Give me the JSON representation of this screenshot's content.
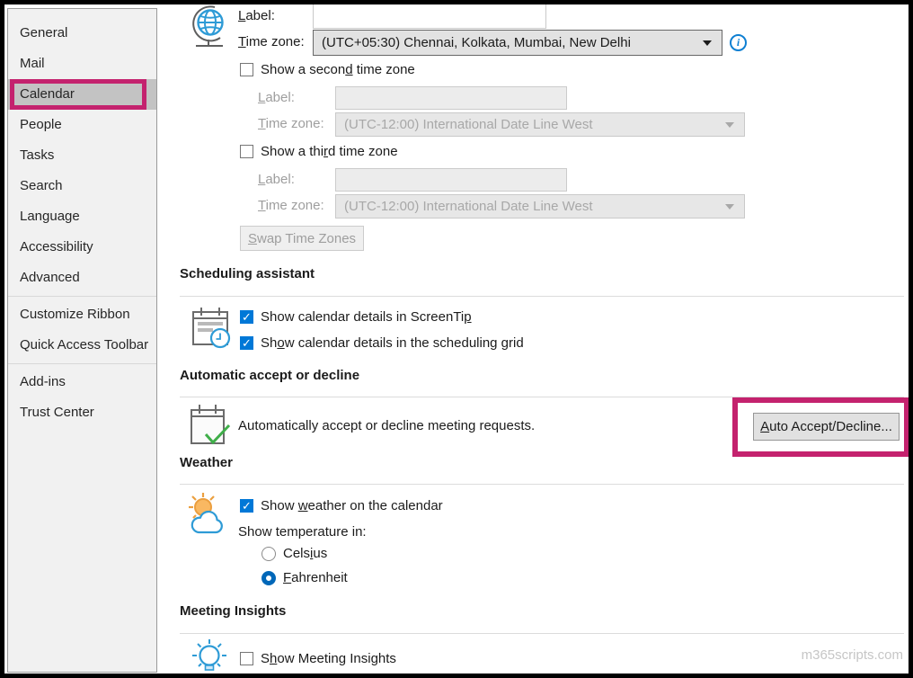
{
  "colors": {
    "annotation_highlight": "#c4226e",
    "checkbox_blue": "#0078d7",
    "radio_blue": "#0067b8",
    "selected_item_bg": "#c3c3c3",
    "icon_blue": "#2e9bd6",
    "check_green": "#3fae49",
    "sun_orange": "#eb9f3f"
  },
  "sidebar": {
    "items": [
      {
        "label": "General",
        "selected": false
      },
      {
        "label": "Mail",
        "selected": false
      },
      {
        "label": "Calendar",
        "selected": true
      },
      {
        "label": "People",
        "selected": false
      },
      {
        "label": "Tasks",
        "selected": false
      },
      {
        "label": "Search",
        "selected": false
      },
      {
        "label": "Language",
        "selected": false
      },
      {
        "label": "Accessibility",
        "selected": false
      },
      {
        "label": "Advanced",
        "selected": false
      },
      {
        "label": "Customize Ribbon",
        "selected": false
      },
      {
        "label": "Quick Access Toolbar",
        "selected": false
      },
      {
        "label": "Add-ins",
        "selected": false
      },
      {
        "label": "Trust Center",
        "selected": false
      }
    ]
  },
  "timezones": {
    "primary": {
      "label": {
        "pre": "",
        "key": "L",
        "post": "abel:"
      },
      "value": "",
      "tz_label": {
        "pre": "",
        "key": "T",
        "post": "ime zone:"
      },
      "tz_value": "(UTC+05:30) Chennai, Kolkata, Mumbai, New Delhi"
    },
    "second": {
      "toggle": {
        "pre": "Show a secon",
        "key": "d",
        "post": " time zone"
      },
      "checked": false,
      "label": {
        "pre": "",
        "key": "L",
        "post": "abel:"
      },
      "value": "",
      "tz_label": {
        "pre": "",
        "key": "T",
        "post": "ime zone:"
      },
      "tz_value": "(UTC-12:00) International Date Line West"
    },
    "third": {
      "toggle": {
        "pre": "Show a thi",
        "key": "r",
        "post": "d time zone"
      },
      "checked": false,
      "label": {
        "pre": "",
        "key": "L",
        "post": "abel:"
      },
      "value": "",
      "tz_label": {
        "pre": "",
        "key": "T",
        "post": "ime zone:"
      },
      "tz_value": "(UTC-12:00) International Date Line West"
    },
    "swap_button": {
      "pre": "",
      "key": "S",
      "post": "wap Time Zones"
    }
  },
  "scheduling": {
    "title": "Scheduling assistant",
    "screentip": {
      "pre": "Show calendar details in ScreenTi",
      "key": "p",
      "post": "",
      "checked": true
    },
    "grid": {
      "pre": "Sh",
      "key": "o",
      "post": "w calendar details in the scheduling grid",
      "checked": true
    }
  },
  "auto_accept": {
    "title": "Automatic accept or decline",
    "description": "Automatically accept or decline meeting requests.",
    "button": {
      "pre": "",
      "key": "A",
      "post": "uto Accept/Decline..."
    }
  },
  "weather": {
    "title": "Weather",
    "show_weather": {
      "pre": "Show ",
      "key": "w",
      "post": "eather on the calendar",
      "checked": true
    },
    "temperature_label": "Show temperature in:",
    "options": {
      "celsius": {
        "pre": "Cels",
        "key": "i",
        "post": "us",
        "selected": false
      },
      "fahrenheit": {
        "pre": "",
        "key": "F",
        "post": "ahrenheit",
        "selected": true
      }
    }
  },
  "insights": {
    "title": "Meeting Insights",
    "show": {
      "pre": "S",
      "key": "h",
      "post": "ow Meeting Insights",
      "checked": false
    }
  },
  "watermark": "m365scripts.com"
}
